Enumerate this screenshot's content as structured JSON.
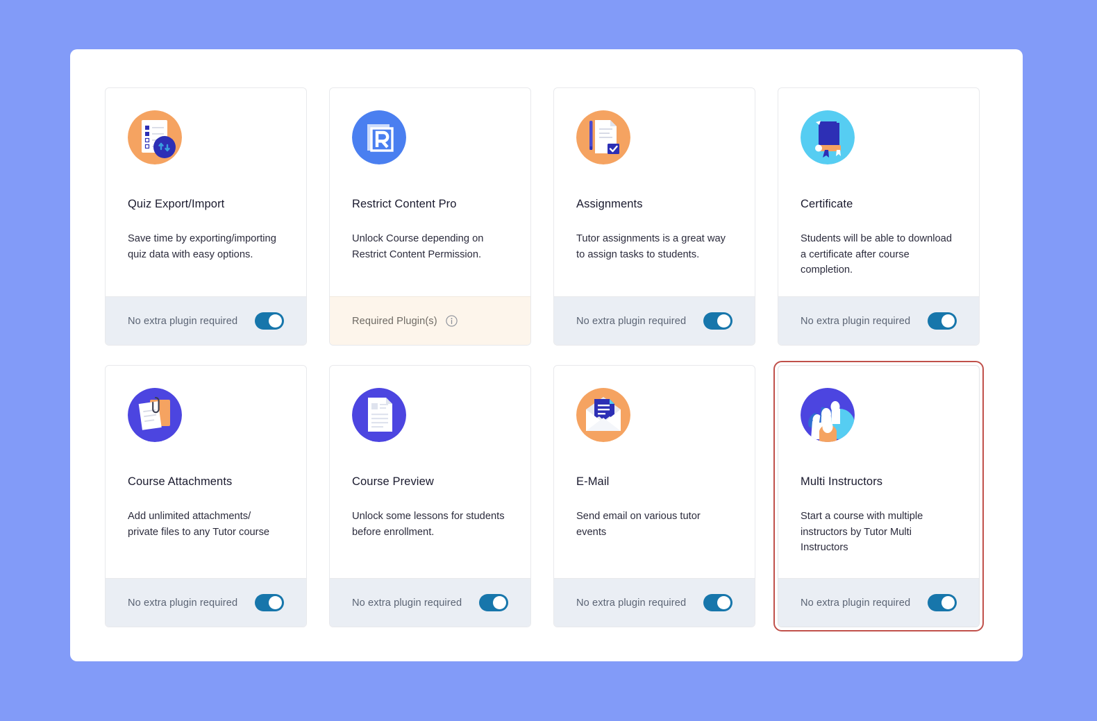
{
  "background_color": "#829bf8",
  "panel": {
    "background_color": "#ffffff"
  },
  "theme": {
    "toggle_on_color": "#1776ab",
    "footer_default_bg": "#eaeef4",
    "footer_warning_bg": "#fdf5eb",
    "highlight_border_color": "#c0504a",
    "card_border_color": "#e8e9ec",
    "title_color": "#1a1a2e",
    "desc_color": "#2b2b3c",
    "footer_label_color": "#5b6474"
  },
  "labels": {
    "no_extra_plugin": "No extra plugin required",
    "required_plugins": "Required Plugin(s)"
  },
  "cards": [
    {
      "id": "quiz-export-import",
      "title": "Quiz Export/Import",
      "description": "Save time by exporting/importing quiz data with easy options.",
      "icon": "quiz-export-import-icon",
      "icon_bg": "#f5a361",
      "footer_type": "toggle",
      "footer_label": "No extra plugin required",
      "toggle_state": "on",
      "highlighted": false
    },
    {
      "id": "restrict-content-pro",
      "title": "Restrict Content Pro",
      "description": "Unlock Course depending on Restrict Content Permission.",
      "icon": "restrict-content-pro-icon",
      "icon_bg": "#4a7ff0",
      "footer_type": "required",
      "footer_label": "Required Plugin(s)",
      "footer_info_icon": "info-icon",
      "toggle_state": "none",
      "highlighted": false
    },
    {
      "id": "assignments",
      "title": "Assignments",
      "description": "Tutor assignments is a great way to assign tasks to students.",
      "icon": "assignments-icon",
      "icon_bg": "#f5a361",
      "footer_type": "toggle",
      "footer_label": "No extra plugin required",
      "toggle_state": "on",
      "highlighted": false
    },
    {
      "id": "certificate",
      "title": "Certificate",
      "description": "Students will be able to download a certificate after course completion.",
      "icon": "certificate-icon",
      "icon_bg": "#56cdf2",
      "footer_type": "toggle",
      "footer_label": "No extra plugin required",
      "toggle_state": "on",
      "highlighted": false
    },
    {
      "id": "course-attachments",
      "title": "Course Attachments",
      "description": "Add unlimited attachments/ private files to any Tutor course",
      "icon": "course-attachments-icon",
      "icon_bg": "#4c45e0",
      "footer_type": "toggle",
      "footer_label": "No extra plugin required",
      "toggle_state": "on",
      "highlighted": false
    },
    {
      "id": "course-preview",
      "title": "Course Preview",
      "description": "Unlock some lessons for students before enrollment.",
      "icon": "course-preview-icon",
      "icon_bg": "#4c45e0",
      "footer_type": "toggle",
      "footer_label": "No extra plugin required",
      "toggle_state": "on",
      "highlighted": false
    },
    {
      "id": "e-mail",
      "title": "E-Mail",
      "description": "Send email on various tutor events",
      "icon": "email-icon",
      "icon_bg": "#f5a361",
      "footer_type": "toggle",
      "footer_label": "No extra plugin required",
      "toggle_state": "on",
      "highlighted": false
    },
    {
      "id": "multi-instructors",
      "title": "Multi Instructors",
      "description": "Start a course with multiple instructors by Tutor Multi Instructors",
      "icon": "multi-instructors-icon",
      "icon_bg": "#4c45e0",
      "footer_type": "toggle",
      "footer_label": "No extra plugin required",
      "toggle_state": "on",
      "highlighted": true
    }
  ]
}
